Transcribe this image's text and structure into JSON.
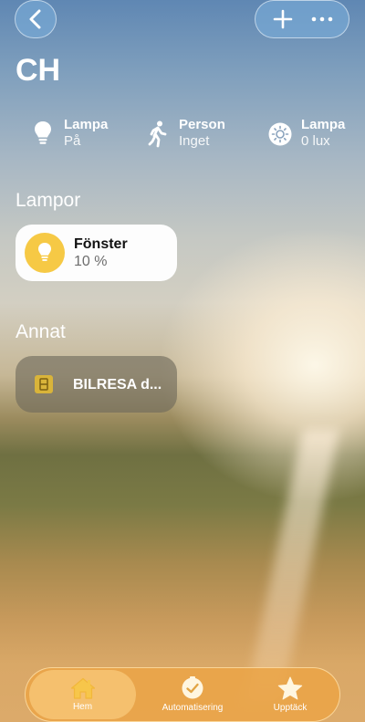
{
  "header": {
    "title": "CH"
  },
  "status": [
    {
      "label": "Lampa",
      "value": "På",
      "icon": "lightbulb-icon"
    },
    {
      "label": "Person",
      "value": "Inget",
      "icon": "walking-person-icon"
    },
    {
      "label": "Lampa",
      "value": "0 lux",
      "icon": "sun-brightness-icon"
    }
  ],
  "sections": {
    "lights": {
      "title": "Lampor",
      "tiles": [
        {
          "name": "Fönster",
          "value": "10 %",
          "icon": "lightbulb-icon"
        }
      ]
    },
    "other": {
      "title": "Annat",
      "tiles": [
        {
          "name": "BILRESA d...",
          "icon": "tag-icon"
        }
      ]
    }
  },
  "tabbar": {
    "tabs": [
      {
        "label": "Hem",
        "icon": "house-icon",
        "active": true
      },
      {
        "label": "Automatisering",
        "icon": "clock-check-icon",
        "active": false
      },
      {
        "label": "Upptäck",
        "icon": "star-icon",
        "active": false
      }
    ]
  },
  "colors": {
    "accent": "#f6c945",
    "tabbar": "#eba546"
  }
}
